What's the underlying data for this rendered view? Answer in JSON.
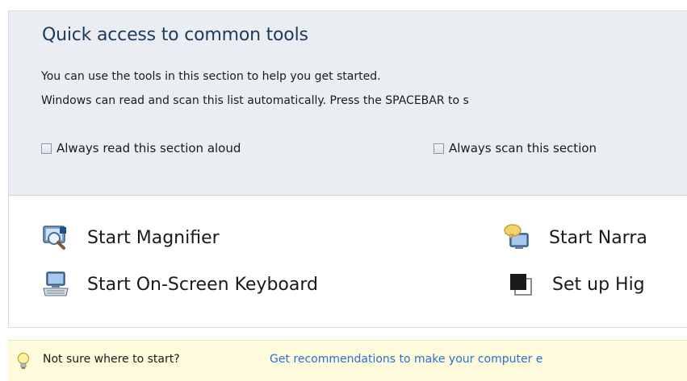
{
  "quick_access": {
    "title": "Quick access to common tools",
    "description": "You can use the tools in this section to help you get started.",
    "scan_note": "Windows can read and scan this list automatically.  Press the SPACEBAR to s",
    "checkbox_read_aloud": {
      "label": "Always read this section aloud",
      "checked": false
    },
    "checkbox_scan": {
      "label": "Always scan this section",
      "checked": false
    }
  },
  "tools": [
    {
      "label": "Start Magnifier",
      "icon": "magnifier-icon"
    },
    {
      "label": "Start On-Screen Keyboard",
      "icon": "keyboard-icon"
    },
    {
      "label": "Start Narra",
      "icon": "narrator-icon"
    },
    {
      "label": "Set up Hig",
      "icon": "high-contrast-icon"
    }
  ],
  "hint": {
    "question": "Not sure where to start?",
    "link": "Get recommendations to make your computer e",
    "icon": "lightbulb-icon"
  },
  "colors": {
    "panel_top": "#eaedf2",
    "link": "#2a6fd1",
    "hint_bg": "#fdfbdc"
  }
}
